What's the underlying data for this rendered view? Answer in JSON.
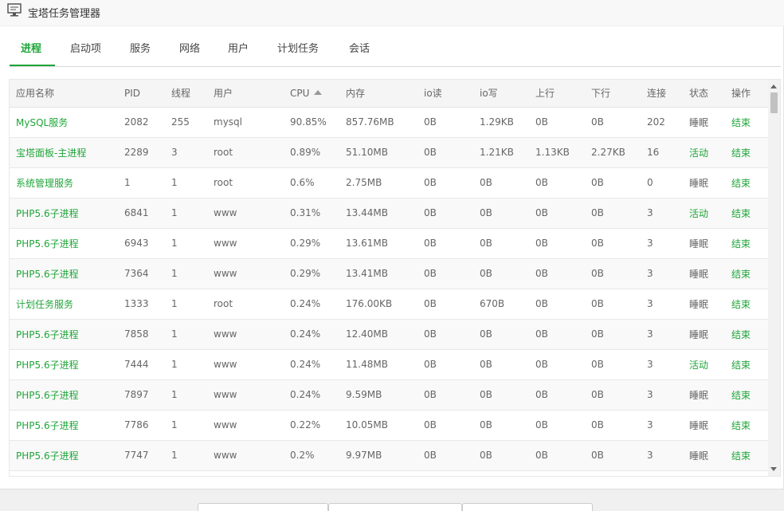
{
  "window": {
    "title": "宝塔任务管理器"
  },
  "tabs": [
    {
      "label": "进程",
      "active": true
    },
    {
      "label": "启动项"
    },
    {
      "label": "服务"
    },
    {
      "label": "网络"
    },
    {
      "label": "用户"
    },
    {
      "label": "计划任务"
    },
    {
      "label": "会话"
    }
  ],
  "table": {
    "headers": {
      "name": "应用名称",
      "pid": "PID",
      "threads": "线程",
      "user": "用户",
      "cpu": "CPU",
      "mem": "内存",
      "io_read": "io读",
      "io_write": "io写",
      "up": "上行",
      "down": "下行",
      "conn": "连接",
      "state": "状态",
      "action": "操作"
    },
    "sort": {
      "column": "CPU",
      "direction": "descending"
    },
    "rows": [
      {
        "name": "MySQL服务",
        "pid": "2082",
        "threads": "255",
        "user": "mysql",
        "cpu": "90.85%",
        "mem": "857.76MB",
        "io_read": "0B",
        "io_write": "1.29KB",
        "up": "0B",
        "down": "0B",
        "conn": "202",
        "state": "睡眠",
        "action": "结束"
      },
      {
        "name": "宝塔面板-主进程",
        "pid": "2289",
        "threads": "3",
        "user": "root",
        "cpu": "0.89%",
        "mem": "51.10MB",
        "io_read": "0B",
        "io_write": "1.21KB",
        "up": "1.13KB",
        "down": "2.27KB",
        "conn": "16",
        "state": "活动",
        "action": "结束"
      },
      {
        "name": "系统管理服务",
        "pid": "1",
        "threads": "1",
        "user": "root",
        "cpu": "0.6%",
        "mem": "2.75MB",
        "io_read": "0B",
        "io_write": "0B",
        "up": "0B",
        "down": "0B",
        "conn": "0",
        "state": "睡眠",
        "action": "结束"
      },
      {
        "name": "PHP5.6子进程",
        "pid": "6841",
        "threads": "1",
        "user": "www",
        "cpu": "0.31%",
        "mem": "13.44MB",
        "io_read": "0B",
        "io_write": "0B",
        "up": "0B",
        "down": "0B",
        "conn": "3",
        "state": "活动",
        "action": "结束"
      },
      {
        "name": "PHP5.6子进程",
        "pid": "6943",
        "threads": "1",
        "user": "www",
        "cpu": "0.29%",
        "mem": "13.61MB",
        "io_read": "0B",
        "io_write": "0B",
        "up": "0B",
        "down": "0B",
        "conn": "3",
        "state": "睡眠",
        "action": "结束"
      },
      {
        "name": "PHP5.6子进程",
        "pid": "7364",
        "threads": "1",
        "user": "www",
        "cpu": "0.29%",
        "mem": "13.41MB",
        "io_read": "0B",
        "io_write": "0B",
        "up": "0B",
        "down": "0B",
        "conn": "3",
        "state": "睡眠",
        "action": "结束"
      },
      {
        "name": "计划任务服务",
        "pid": "1333",
        "threads": "1",
        "user": "root",
        "cpu": "0.24%",
        "mem": "176.00KB",
        "io_read": "0B",
        "io_write": "670B",
        "up": "0B",
        "down": "0B",
        "conn": "3",
        "state": "睡眠",
        "action": "结束"
      },
      {
        "name": "PHP5.6子进程",
        "pid": "7858",
        "threads": "1",
        "user": "www",
        "cpu": "0.24%",
        "mem": "12.40MB",
        "io_read": "0B",
        "io_write": "0B",
        "up": "0B",
        "down": "0B",
        "conn": "3",
        "state": "睡眠",
        "action": "结束"
      },
      {
        "name": "PHP5.6子进程",
        "pid": "7444",
        "threads": "1",
        "user": "www",
        "cpu": "0.24%",
        "mem": "11.48MB",
        "io_read": "0B",
        "io_write": "0B",
        "up": "0B",
        "down": "0B",
        "conn": "3",
        "state": "活动",
        "action": "结束"
      },
      {
        "name": "PHP5.6子进程",
        "pid": "7897",
        "threads": "1",
        "user": "www",
        "cpu": "0.24%",
        "mem": "9.59MB",
        "io_read": "0B",
        "io_write": "0B",
        "up": "0B",
        "down": "0B",
        "conn": "3",
        "state": "睡眠",
        "action": "结束"
      },
      {
        "name": "PHP5.6子进程",
        "pid": "7786",
        "threads": "1",
        "user": "www",
        "cpu": "0.22%",
        "mem": "10.05MB",
        "io_read": "0B",
        "io_write": "0B",
        "up": "0B",
        "down": "0B",
        "conn": "3",
        "state": "睡眠",
        "action": "结束"
      },
      {
        "name": "PHP5.6子进程",
        "pid": "7747",
        "threads": "1",
        "user": "www",
        "cpu": "0.2%",
        "mem": "9.97MB",
        "io_read": "0B",
        "io_write": "0B",
        "up": "0B",
        "down": "0B",
        "conn": "3",
        "state": "睡眠",
        "action": "结束"
      }
    ]
  },
  "colors": {
    "accent": "#20a53a",
    "text": "#666666",
    "header_bg": "#f5f5f5"
  },
  "icons": {
    "window": "monitor-icon",
    "sort": "sort-ascending-arrow-icon"
  }
}
